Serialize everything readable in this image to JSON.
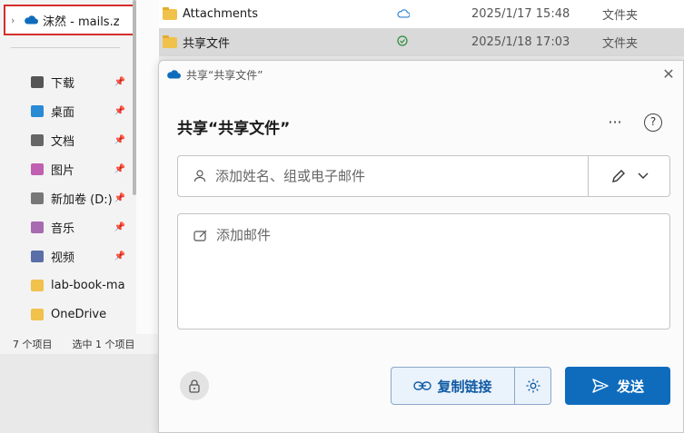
{
  "explorer": {
    "tree_top_label": "沫然 - mails.z",
    "nav_items": [
      {
        "label": "下载",
        "icon": "download-icon",
        "color": "#555555"
      },
      {
        "label": "桌面",
        "icon": "desktop-icon",
        "color": "#2a8ad4"
      },
      {
        "label": "文档",
        "icon": "document-icon",
        "color": "#666666"
      },
      {
        "label": "图片",
        "icon": "pictures-icon",
        "color": "#c15fb0"
      },
      {
        "label": "新加卷 (D:)",
        "icon": "drive-icon",
        "color": "#777777"
      },
      {
        "label": "音乐",
        "icon": "music-icon",
        "color": "#a86ab0"
      },
      {
        "label": "视频",
        "icon": "video-icon",
        "color": "#5a6fa8"
      },
      {
        "label": "lab-book-ma",
        "icon": "folder-icon",
        "color": "#f0c14b"
      },
      {
        "label": "OneDrive",
        "icon": "folder-icon",
        "color": "#f0c14b"
      }
    ],
    "status": {
      "count": "7 个项目",
      "selected": "选中 1 个项目"
    }
  },
  "files": [
    {
      "name": "Attachments",
      "sync": "cloud-icon",
      "date": "2025/1/17 15:48",
      "kind": "文件夹",
      "selected": false
    },
    {
      "name": "共享文件",
      "sync": "check-icon",
      "date": "2025/1/18 17:03",
      "kind": "文件夹",
      "selected": true
    }
  ],
  "dialog": {
    "title": "共享“共享文件”",
    "heading": "共享“共享文件”",
    "more": "···",
    "help": "?",
    "people_placeholder": "添加姓名、组或电子邮件",
    "message_placeholder": "添加邮件",
    "copy_label": "复制链接",
    "send_label": "发送",
    "close": "✕"
  },
  "colors": {
    "accent": "#0f6cbd",
    "highlight_border": "#d42d2d"
  }
}
